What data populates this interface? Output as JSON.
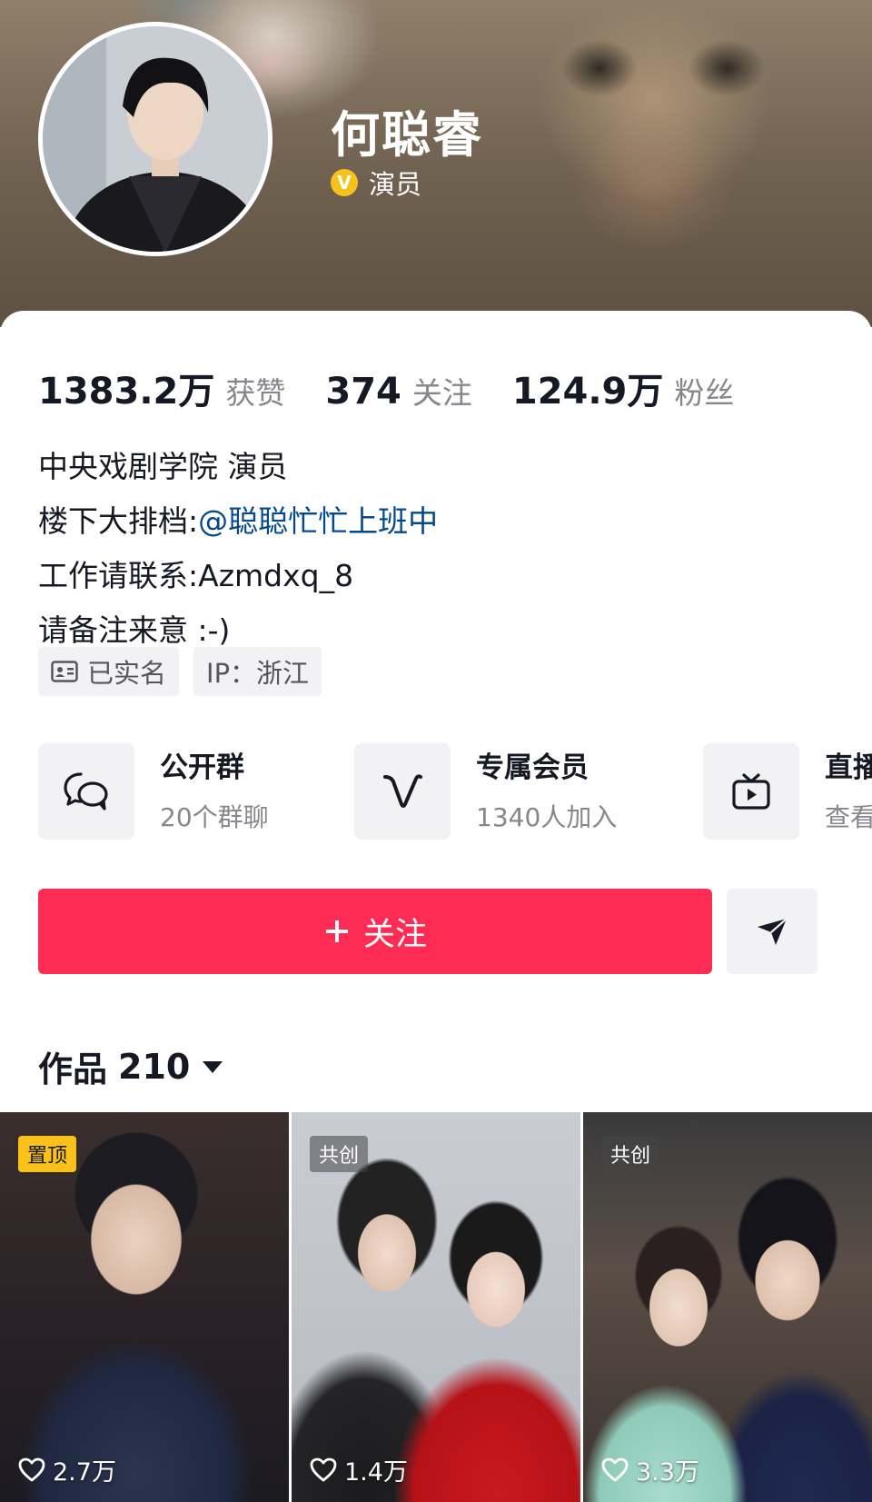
{
  "profile": {
    "name": "何聪睿",
    "verified_label": "演员",
    "verified_icon": "verified-v-badge",
    "accent_color": "#f4c21b"
  },
  "stats": [
    {
      "value": "1383.2万",
      "label": "获赞"
    },
    {
      "value": "374",
      "label": "关注"
    },
    {
      "value": "124.9万",
      "label": "粉丝"
    }
  ],
  "bio": {
    "line1": "中央戏剧学院 演员",
    "line2_prefix": "楼下大排档:",
    "line2_mention": "@聪聪忙忙上班中",
    "line3": "工作请联系:Azmdxq_8",
    "line4": "请备注来意 :-)"
  },
  "tags": [
    {
      "icon": "id-card-icon",
      "label": "已实名"
    },
    {
      "label": "IP：浙江"
    }
  ],
  "features": [
    {
      "icon": "group-chat-icon",
      "title": "公开群",
      "subtitle": "20个群聊"
    },
    {
      "icon": "membership-v-icon",
      "title": "专属会员",
      "subtitle": "1340人加入"
    },
    {
      "icon": "live-tv-icon",
      "title": "直播",
      "subtitle": "查看"
    }
  ],
  "actions": {
    "follow_label": "关注",
    "follow_color": "#fe2c55",
    "share_icon": "send-arrow-icon"
  },
  "works": {
    "label": "作品",
    "count": "210"
  },
  "videos": [
    {
      "badge": "置顶",
      "likes": "2.7万"
    },
    {
      "badge": "共创",
      "likes": "1.4万"
    },
    {
      "badge": "共创",
      "likes": "3.3万"
    }
  ]
}
